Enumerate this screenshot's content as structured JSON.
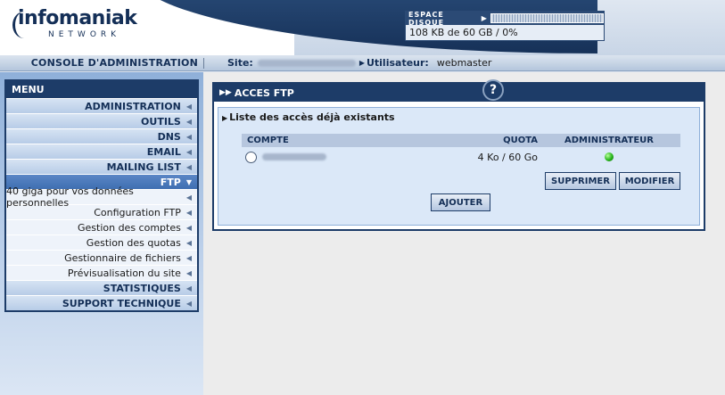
{
  "header": {
    "logo_word": "infomaniak",
    "logo_sub": "NETWORK",
    "disk_label": "ESPACE DISQUE",
    "disk_value": "108 KB de 60 GB / 0%",
    "disk_percent": 0
  },
  "topbar": {
    "console": "CONSOLE D'ADMINISTRATION",
    "site_label": "Site:",
    "user_label": "Utilisateur:",
    "user_value": "webmaster"
  },
  "menu": {
    "title": "MENU",
    "items": [
      {
        "label": "ADMINISTRATION",
        "kind": "section"
      },
      {
        "label": "OUTILS",
        "kind": "section"
      },
      {
        "label": "DNS",
        "kind": "section"
      },
      {
        "label": "EMAIL",
        "kind": "section"
      },
      {
        "label": "MAILING LIST",
        "kind": "section"
      },
      {
        "label": "FTP",
        "kind": "active"
      },
      {
        "label": "40 giga pour vos données personnelles",
        "kind": "sub"
      },
      {
        "label": "Configuration FTP",
        "kind": "sub"
      },
      {
        "label": "Gestion des comptes",
        "kind": "sub"
      },
      {
        "label": "Gestion des quotas",
        "kind": "sub"
      },
      {
        "label": "Gestionnaire de fichiers",
        "kind": "sub"
      },
      {
        "label": "Prévisualisation du site",
        "kind": "sub"
      },
      {
        "label": "STATISTIQUES",
        "kind": "section"
      },
      {
        "label": "SUPPORT TECHNIQUE",
        "kind": "section"
      }
    ]
  },
  "panel": {
    "title": "ACCES FTP",
    "help": "?",
    "subtitle": "Liste des accès déjà existants",
    "columns": {
      "account": "COMPTE",
      "quota": "QUOTA",
      "admin": "ADMINISTRATEUR"
    },
    "rows": [
      {
        "quota": "4 Ko / 60 Go",
        "admin_status_color": "#27b41a"
      }
    ],
    "buttons": {
      "delete": "SUPPRIMER",
      "edit": "MODIFIER",
      "add": "AJOUTER"
    }
  },
  "colors": {
    "navy": "#1d3c68",
    "active": "#4a78bb"
  }
}
